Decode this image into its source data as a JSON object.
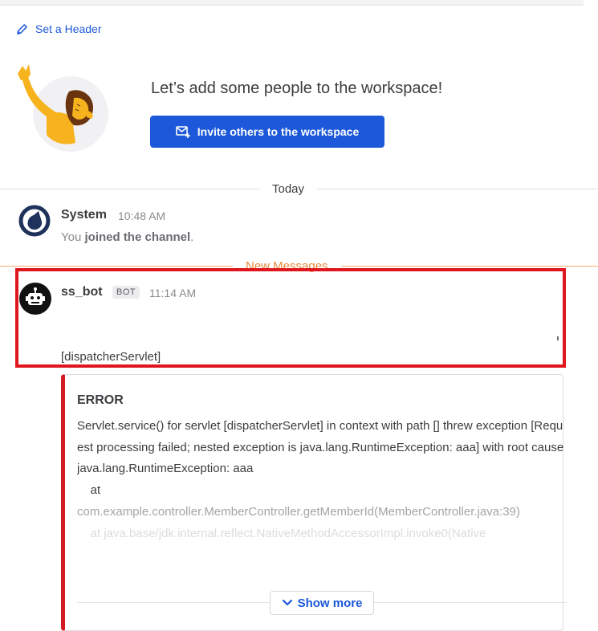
{
  "header": {
    "set_header_label": "Set a Header"
  },
  "intro": {
    "title": "Let’s add some people to the workspace!",
    "invite_button_label": "Invite others to the workspace"
  },
  "separators": {
    "today": "Today",
    "new_messages": "New Messages"
  },
  "messages": [
    {
      "author": "System",
      "time": "10:48 AM",
      "text_prefix": "You ",
      "text_bold": "joined the channel",
      "text_suffix": "."
    },
    {
      "author": "ss_bot",
      "badge": "BOT",
      "time": "11:14 AM",
      "text": "[dispatcherServlet]",
      "attachment": {
        "title": "ERROR",
        "lines": [
          "Servlet.service() for servlet [dispatcherServlet] in context with path [] threw exception [Request processing failed; nested exception is java.lang.RuntimeException: aaa] with root cause",
          "java.lang.RuntimeException: aaa",
          "    at",
          "com.example.controller.MemberController.getMemberId(MemberController.java:39)",
          "    at java.base/jdk.internal.reflect.NativeMethodAccessorImpl.invoke0(Native"
        ],
        "show_more_label": "Show more"
      }
    }
  ],
  "colors": {
    "accent": "#1c58d9",
    "highlight_border": "#e0161e",
    "attachment_border": "#d41a22",
    "new_messages": "#e68a3a"
  },
  "icons": {
    "set_header": "pencil-icon",
    "invite": "mail-plus-icon",
    "system_avatar": "mattermost-logo-icon",
    "bot_avatar": "robot-icon",
    "show_more": "chevron-down-icon"
  }
}
